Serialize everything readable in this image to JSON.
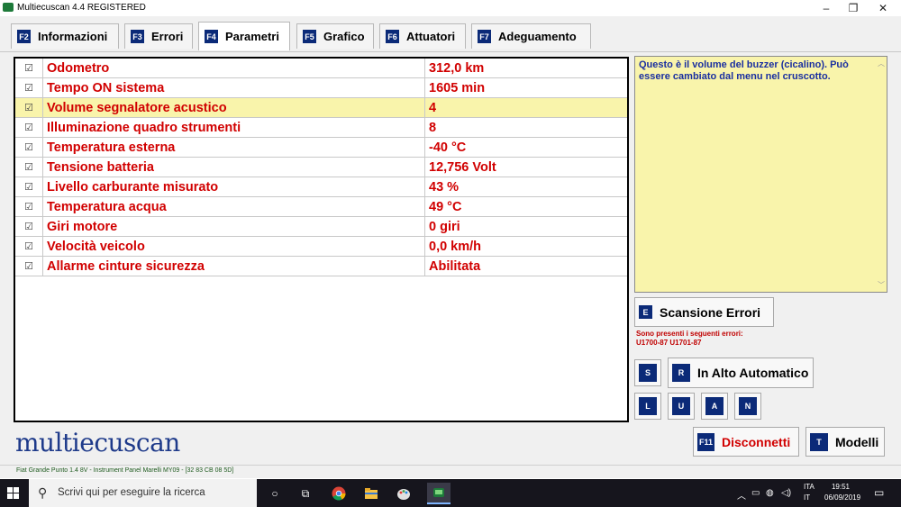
{
  "window": {
    "title": "Multiecuscan 4.4 REGISTERED",
    "controls": [
      "–",
      "❐",
      "✕"
    ]
  },
  "tabs": [
    {
      "key": "F2",
      "label": "Informazioni",
      "active": false
    },
    {
      "key": "F3",
      "label": "Errori",
      "active": false
    },
    {
      "key": "F4",
      "label": "Parametri",
      "active": true
    },
    {
      "key": "F5",
      "label": "Grafico",
      "active": false
    },
    {
      "key": "F6",
      "label": "Attuatori",
      "active": false
    },
    {
      "key": "F7",
      "label": "Adeguamento",
      "active": false
    }
  ],
  "parameters": [
    {
      "checked": "☑",
      "name": "Odometro",
      "value": "312,0 km"
    },
    {
      "checked": "☑",
      "name": "Tempo ON sistema",
      "value": "1605 min"
    },
    {
      "checked": "☑",
      "name": "Volume segnalatore acustico",
      "value": "4",
      "selected": true
    },
    {
      "checked": "☑",
      "name": "Illuminazione quadro strumenti",
      "value": "8"
    },
    {
      "checked": "☑",
      "name": "Temperatura esterna",
      "value": "-40 °C"
    },
    {
      "checked": "☑",
      "name": "Tensione batteria",
      "value": "12,756 Volt"
    },
    {
      "checked": "☑",
      "name": "Livello carburante misurato",
      "value": "43 %"
    },
    {
      "checked": "☑",
      "name": "Temperatura acqua",
      "value": "49 °C"
    },
    {
      "checked": "☑",
      "name": "Giri motore",
      "value": "0 giri"
    },
    {
      "checked": "☑",
      "name": "Velocità veicolo",
      "value": "0,0 km/h"
    },
    {
      "checked": "☑",
      "name": "Allarme cinture sicurezza",
      "value": "Abilitata"
    }
  ],
  "info": {
    "text": "Questo è il volume del buzzer (cicalino). Può essere cambiato dal menu nel cruscotto."
  },
  "scan": {
    "key": "E",
    "label": "Scansione Errori",
    "note_line1": "Sono presenti i seguenti errori:",
    "note_line2": "U1700-87 U1701-87"
  },
  "controls": {
    "s_key": "S",
    "auto_key": "R",
    "auto_label": "In Alto Automatico",
    "keys": [
      "L",
      "U",
      "A",
      "N"
    ]
  },
  "bottom": {
    "logo": "multiecuscan",
    "disconnect_key": "F11",
    "disconnect_label": "Disconnetti",
    "models_key": "T",
    "models_label": "Modelli",
    "status": "Fiat Grande Punto 1.4 8V - Instrument Panel Marelli MY09 - [32 83 CB 08 5D]"
  },
  "taskbar": {
    "search_placeholder": "Scrivi qui per eseguire la ricerca",
    "lang_top": "ITA",
    "lang_bottom": "IT",
    "time": "19:51",
    "date": "06/09/2019"
  }
}
